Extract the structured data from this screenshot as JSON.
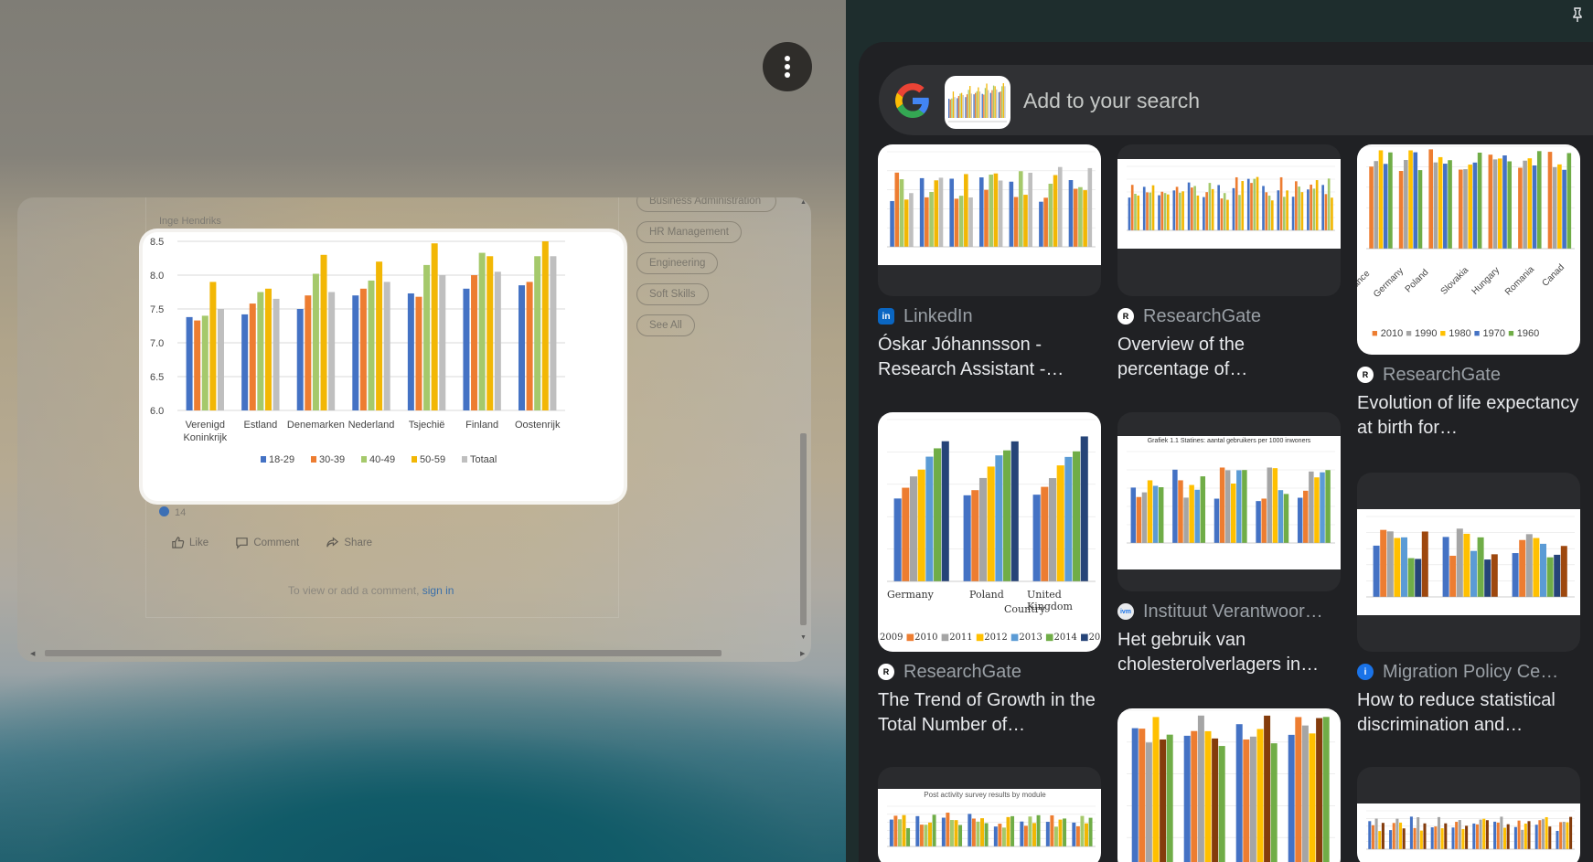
{
  "post": {
    "author": "Inge Hendriks",
    "skills": [
      "Business Administration",
      "HR Management",
      "Engineering",
      "Soft Skills",
      "See All"
    ],
    "reaction_count": "14",
    "actions": {
      "like": "Like",
      "comment": "Comment",
      "share": "Share"
    },
    "comment_note": "To view or add a comment,",
    "sign_in": "sign in"
  },
  "chart_data": {
    "type": "bar",
    "categories": [
      "Verenigd Koninkrijk",
      "Estland",
      "Denemarken",
      "Nederland",
      "Tsjechië",
      "Finland",
      "Oostenrijk"
    ],
    "series": [
      {
        "name": "18-29",
        "color": "#4472c4",
        "values": [
          7.38,
          7.42,
          7.5,
          7.7,
          7.73,
          7.8,
          7.85
        ]
      },
      {
        "name": "30-39",
        "color": "#ed7d31",
        "values": [
          7.33,
          7.58,
          7.7,
          7.8,
          7.68,
          8.0,
          7.9
        ]
      },
      {
        "name": "40-49",
        "color": "#a5c96b",
        "values": [
          7.4,
          7.75,
          8.02,
          7.92,
          8.15,
          8.33,
          8.28
        ]
      },
      {
        "name": "50-59",
        "color": "#f2b705",
        "values": [
          7.9,
          7.8,
          8.3,
          8.2,
          8.47,
          8.28,
          8.5
        ]
      },
      {
        "name": "Totaal",
        "color": "#bfbfbf",
        "values": [
          7.5,
          7.65,
          7.75,
          7.9,
          8.0,
          8.05,
          8.28
        ]
      }
    ],
    "yticks": [
      "6.0",
      "6.5",
      "7.0",
      "7.5",
      "8.0",
      "8.5"
    ],
    "ylim": [
      6.0,
      8.5
    ],
    "legend": "bottom"
  },
  "lens": {
    "search_placeholder": "Add to your search",
    "results": [
      {
        "source": "LinkedIn",
        "title": "Óskar Jóhannsson - Research Assistant -…",
        "icon": "linkedin-icon",
        "icon_color": "#0a66c2"
      },
      {
        "source": "ResearchGate",
        "title": "Overview of the percentage of…",
        "icon": "researchgate-icon",
        "icon_color": "#ffffff"
      },
      {
        "source": "ResearchGate",
        "title": "Evolution of life expectancy at birth for…",
        "icon": "researchgate-icon",
        "icon_color": "#ffffff",
        "thumb_labels": [
          "ance",
          "Germany",
          "Poland",
          "Slovakia",
          "Hungary",
          "Romania",
          "Canad"
        ],
        "thumb_legend": [
          "2010",
          "1990",
          "1980",
          "1970",
          "1960"
        ]
      },
      {
        "source": "ResearchGate",
        "title": "The Trend of Growth in the Total Number of…",
        "icon": "researchgate-icon",
        "icon_color": "#ffffff",
        "thumb_labels": [
          "Germany",
          "Poland",
          "United Kingdom"
        ],
        "thumb_axis": "Country",
        "thumb_legend": [
          "2009",
          "2010",
          "2011",
          "2012",
          "2013",
          "2014",
          "20"
        ]
      },
      {
        "source": "Instituut Verantwoor…",
        "title": "Het gebruik van cholesterolverlagers in…",
        "icon": "institute-icon",
        "icon_color": "#e8eaed",
        "thumb_title": "Grafiek 1.1 Statines: aantal gebruikers per 1000 inwoners"
      },
      {
        "source": "Migration Policy Ce…",
        "title": "How to reduce statistical discrimination and…",
        "icon": "migration-policy-icon",
        "icon_color": "#1a73e8"
      },
      {
        "thumb_title": "Post activity survey results by module"
      }
    ]
  }
}
